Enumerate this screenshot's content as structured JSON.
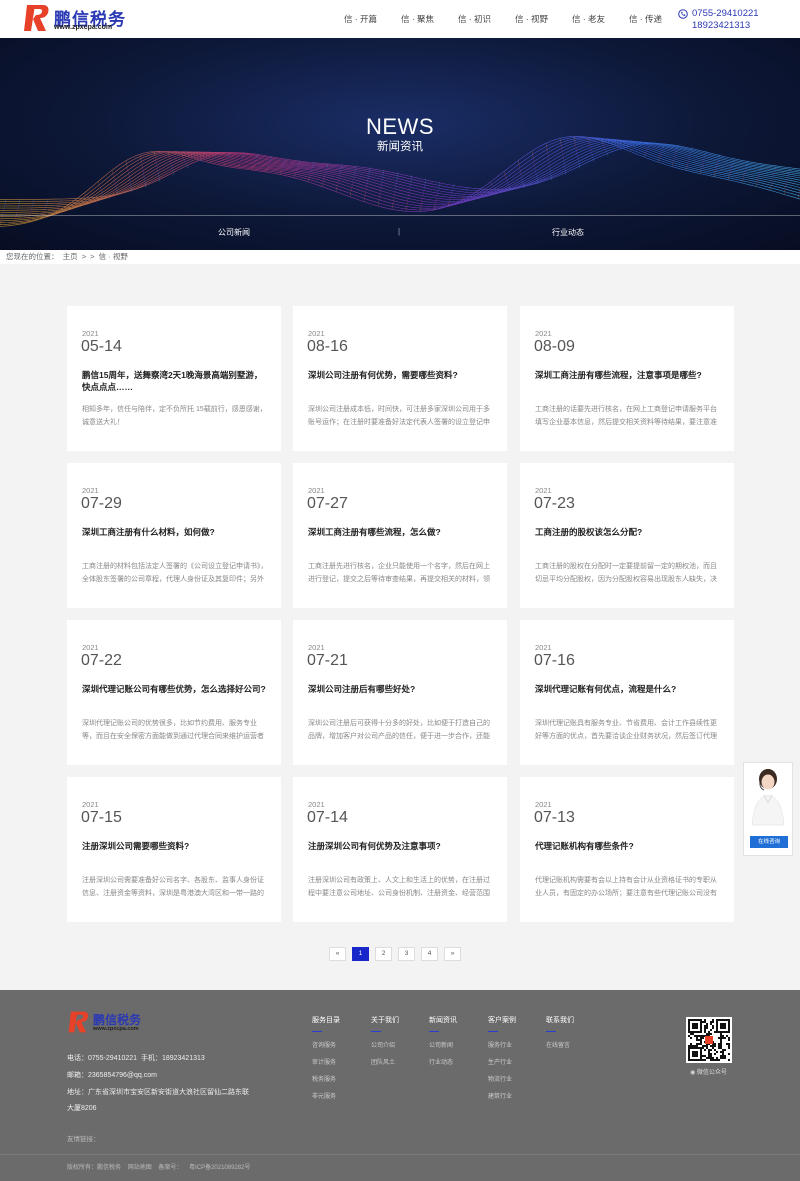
{
  "brand": {
    "name": "鹏信税务",
    "url": "www.zpxcpa.com",
    "colors": {
      "primary": "#2b39b4",
      "accent": "#e8412a",
      "button": "#1827c9"
    }
  },
  "nav": {
    "items": [
      {
        "label": "信 · 开篇"
      },
      {
        "label": "信 · 聚焦"
      },
      {
        "label": "信 · 初识"
      },
      {
        "label": "信 · 视野"
      },
      {
        "label": "信 · 老友"
      },
      {
        "label": "信 · 传递"
      }
    ]
  },
  "contact": {
    "phone1": "0755-29410221",
    "phone2": "18923421313",
    "icon": "phone-icon"
  },
  "banner": {
    "title": "NEWS",
    "subtitle": "新闻资讯",
    "tabs": [
      {
        "label": "公司新闻"
      },
      {
        "label": "行业动态"
      }
    ],
    "separator": "|"
  },
  "breadcrumb": {
    "prefix": "您现在的位置：",
    "home": "主页",
    "sep": ">",
    "sep2": ">",
    "current": "信 · 视野"
  },
  "articles": [
    {
      "year": "2021",
      "date": "05-14",
      "title": "鹏信15周年，送舞察湾2天1晚海景高端别墅游，快点点点……",
      "summary": "相知多年，信任与陪伴，定不负所托 15载前行，感恩感谢，诚意送大礼！"
    },
    {
      "year": "2021",
      "date": "08-16",
      "title": "深圳公司注册有何优势，需要哪些资料?",
      "summary": "深圳公司注册成本低，时间快，可注册多家深圳公司用于多账号运作；在注册时要准备好法定代表人签署的设立登记申请书"
    },
    {
      "year": "2021",
      "date": "08-09",
      "title": "深圳工商注册有哪些流程，注意事项是哪些?",
      "summary": "工商注册的话要先进行核名，在网上工商登记申请服务平台填写企业基本信息，然后提交相关资料等待结果，要注意准备一"
    },
    {
      "year": "2021",
      "date": "07-29",
      "title": "深圳工商注册有什么材料，如何做?",
      "summary": "工商注册的材料包括法定人签署的《公司设立登记申请书》，全体股东签署的公司章程，代理人身份证及其复印件；另外核"
    },
    {
      "year": "2021",
      "date": "07-27",
      "title": "深圳工商注册有哪些流程，怎么做?",
      "summary": "工商注册先进行核名，企业只能使用一个名字，然后在网上进行登记，提交之后等待审查结果，再提交相关的材料，领取营"
    },
    {
      "year": "2021",
      "date": "07-23",
      "title": "工商注册的股权该怎么分配?",
      "summary": "工商注册的股权在分配时一定要提前留一定的期权池，而且切忌平均分配股权，因为分配股权容易出现股东人缺失，决策陷"
    },
    {
      "year": "2021",
      "date": "07-22",
      "title": "深圳代理记账公司有哪些优势，怎么选择好公司?",
      "summary": "深圳代理记账公司的优势很多，比如节约费用、服务专业等，而且在安全保密方面能做到通过代理合同来维护运营者权益；"
    },
    {
      "year": "2021",
      "date": "07-21",
      "title": "深圳公司注册后有哪些好处?",
      "summary": "深圳公司注册后可获得十分多的好处，比如便于打造自己的品牌，增加客户对公司产品的信任，便于进一步合作，还能便于"
    },
    {
      "year": "2021",
      "date": "07-16",
      "title": "深圳代理记账有何优点，流程是什么?",
      "summary": "深圳代理记账具有服务专业、节省费用、会计工作县续性更好等方面的优点，首先要洽谈企业财务状况，然后签订代理记账"
    },
    {
      "year": "2021",
      "date": "07-15",
      "title": "注册深圳公司需要哪些资料?",
      "summary": "注册深圳公司需要准备好公司名字、各股东、监事人身份证信息、注册资金等资料，深圳是粤港澳大湾区和一带一路的核心"
    },
    {
      "year": "2021",
      "date": "07-14",
      "title": "注册深圳公司有何优势及注意事项?",
      "summary": "注册深圳公司有政策上、人文上和生活上的优势，在注册过程中要注意公司地址、公司身份机制、注册资金、经营范围等方"
    },
    {
      "year": "2021",
      "date": "07-13",
      "title": "代理记账机构有哪些条件?",
      "summary": "代理记账机构需要有会以上持有会计从业资格证书的专职从业人员，有固定的办公场所；要注意有些代理记账公司没有专业"
    }
  ],
  "pagination": {
    "prev": "«",
    "pages": [
      "1",
      "2",
      "3",
      "4"
    ],
    "current": "1",
    "next": "»"
  },
  "float_consult": {
    "button": "在线咨询"
  },
  "footer": {
    "phone_label": "电话：",
    "phone": "0755-29410221",
    "mobile_label": "手机：",
    "mobile": "18923421313",
    "email_label": "邮箱：",
    "email": "2365854796@qq.com",
    "address_label": "地址：",
    "address_line1": "广东省深圳市宝安区新安街道大浪社区留仙二路东联",
    "address_line2": "大厦8206",
    "columns": [
      {
        "title": "服务目录",
        "items": [
          "咨询服务",
          "审计服务",
          "税务服务",
          "非元服务"
        ]
      },
      {
        "title": "关于我们",
        "items": [
          "公司介绍",
          "团队风土"
        ]
      },
      {
        "title": "新闻资讯",
        "items": [
          "公司新闻",
          "行业动态"
        ]
      },
      {
        "title": "客户案例",
        "items": [
          "服务行业",
          "生产行业",
          "物流行业",
          "建筑行业"
        ]
      },
      {
        "title": "联系我们",
        "items": [
          "在线留言"
        ]
      }
    ],
    "qr_label": "微信公众号",
    "links_label": "友情链接：",
    "copyright": [
      "版权所有：鹏信税务",
      "网站地图",
      "备案号：",
      "粤ICP备2021089282号"
    ]
  }
}
